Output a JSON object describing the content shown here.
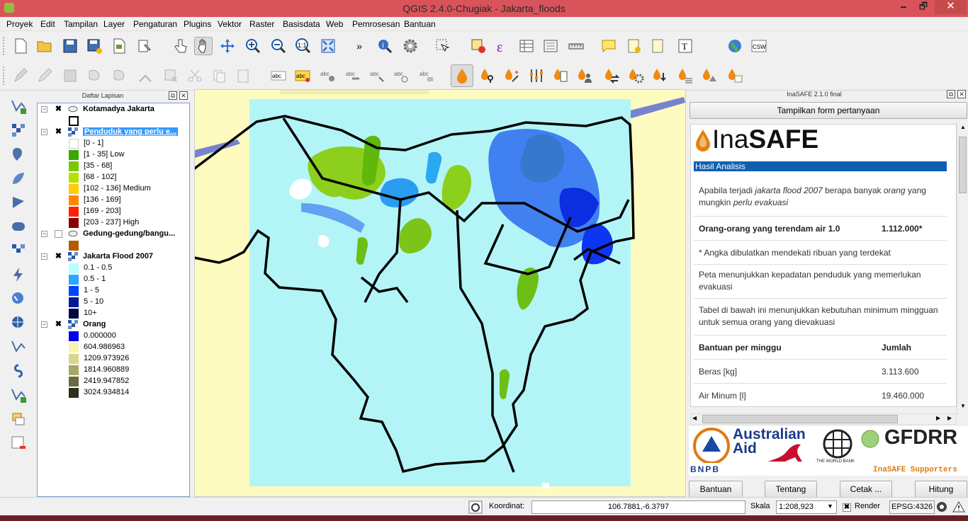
{
  "window": {
    "title": "QGIS 2.4.0-Chugiak - Jakarta_floods",
    "minimize": "🗕",
    "maximize": "🗗",
    "close": "✕"
  },
  "menu": [
    "Proyek",
    "Edit",
    "Tampilan",
    "Layer",
    "Pengaturan",
    "Plugins",
    "Vektor",
    "Raster",
    "Basisdata",
    "Web",
    "Pemrosesan",
    "Bantuan"
  ],
  "layers_panel": {
    "title": "Daftar Lapisan",
    "layers": [
      {
        "name": "Kotamadya Jakarta",
        "checked": "✖"
      },
      {
        "name": "Penduduk yang perlu e...",
        "checked": "✖"
      },
      {
        "name": "Gedung-gedung/bangu...",
        "checked": ""
      },
      {
        "name": "Jakarta Flood 2007",
        "checked": "✖"
      },
      {
        "name": "Orang",
        "checked": "✖"
      }
    ],
    "penduduk_legend": [
      {
        "label": "[0 - 1]",
        "color": "#ffffff"
      },
      {
        "label": "[1 - 35] Low",
        "color": "#38a800"
      },
      {
        "label": "[35 - 68]",
        "color": "#7ac800"
      },
      {
        "label": "[68 - 102]",
        "color": "#b8e000"
      },
      {
        "label": "[102 - 136] Medium",
        "color": "#ffcc00"
      },
      {
        "label": "[136 - 169]",
        "color": "#ff8800"
      },
      {
        "label": "[169 - 203]",
        "color": "#ff2200"
      },
      {
        "label": "[203 - 237] High",
        "color": "#880000"
      }
    ],
    "flood_legend": [
      {
        "label": "0.1 - 0.5",
        "color": "#b8ffff"
      },
      {
        "label": "0.5 - 1",
        "color": "#2aa8ff"
      },
      {
        "label": "1 - 5",
        "color": "#0044ff"
      },
      {
        "label": "5 - 10",
        "color": "#001a9a"
      },
      {
        "label": "10+",
        "color": "#000a40"
      }
    ],
    "orang_legend": [
      {
        "label": "0.000000",
        "color": "#0000ee"
      },
      {
        "label": "604.986963",
        "color": "#f5f5b0"
      },
      {
        "label": "1209.973926",
        "color": "#d7d78c"
      },
      {
        "label": "1814.960889",
        "color": "#a8a864"
      },
      {
        "label": "2419.947852",
        "color": "#6a6a40"
      },
      {
        "label": "3024.934814",
        "color": "#2e2e20"
      }
    ]
  },
  "inasafe": {
    "panel_title": "InaSAFE 2.1.0 final",
    "form_button": "Tampilkan form pertanyaan",
    "logo_light": "Ina",
    "logo_bold": "SAFE",
    "section": "Hasil Analisis",
    "q_pre": "Apabila terjadi ",
    "q_it1": "jakarta flood 2007",
    "q_mid": " berapa banyak ",
    "q_it2": "orang",
    "q_mid2": " yang mungkin ",
    "q_it3": "perlu evakuasi",
    "affected_label": "Orang-orang yang terendam air 1.0",
    "affected_value": "1.112.000*",
    "note": "* Angka dibulatkan mendekati ribuan yang terdekat",
    "map_note": "Peta menunjukkan kepadatan penduduk yang memerlukan evakuasi",
    "table_note": "Tabel di bawah ini menunjukkan kebutuhan minimum mingguan untuk semua orang yang dievakuasi",
    "col1": "Bantuan per minggu",
    "col2": "Jumlah",
    "rows": [
      {
        "item": "Beras [kg]",
        "value": "3.113.600"
      },
      {
        "item": "Air Minum [l]",
        "value": "19.460.000"
      }
    ],
    "sponsors": {
      "bnpb": "BNPB",
      "aus1": "Australian",
      "aus2": "Aid",
      "wb": "THE WORLD BANK",
      "gfdrr": "GFDRR",
      "supporters": "InaSAFE Supporters"
    },
    "buttons": {
      "help": "Bantuan",
      "about": "Tentang",
      "print": "Cetak ...",
      "run": "Hitung"
    }
  },
  "statusbar": {
    "coord_label": "Koordinat:",
    "coord_value": "106.7881,-6.3797",
    "scale_label": "Skala",
    "scale_value": "1:208,923",
    "render_label": "Render",
    "render_check": "✖",
    "epsg": "EPSG:4326"
  },
  "colors": {
    "accent": "#0e5fb0",
    "titlebar": "#d8545a",
    "flood_bg": "#b3f5f7",
    "selection": "#3399ff"
  }
}
